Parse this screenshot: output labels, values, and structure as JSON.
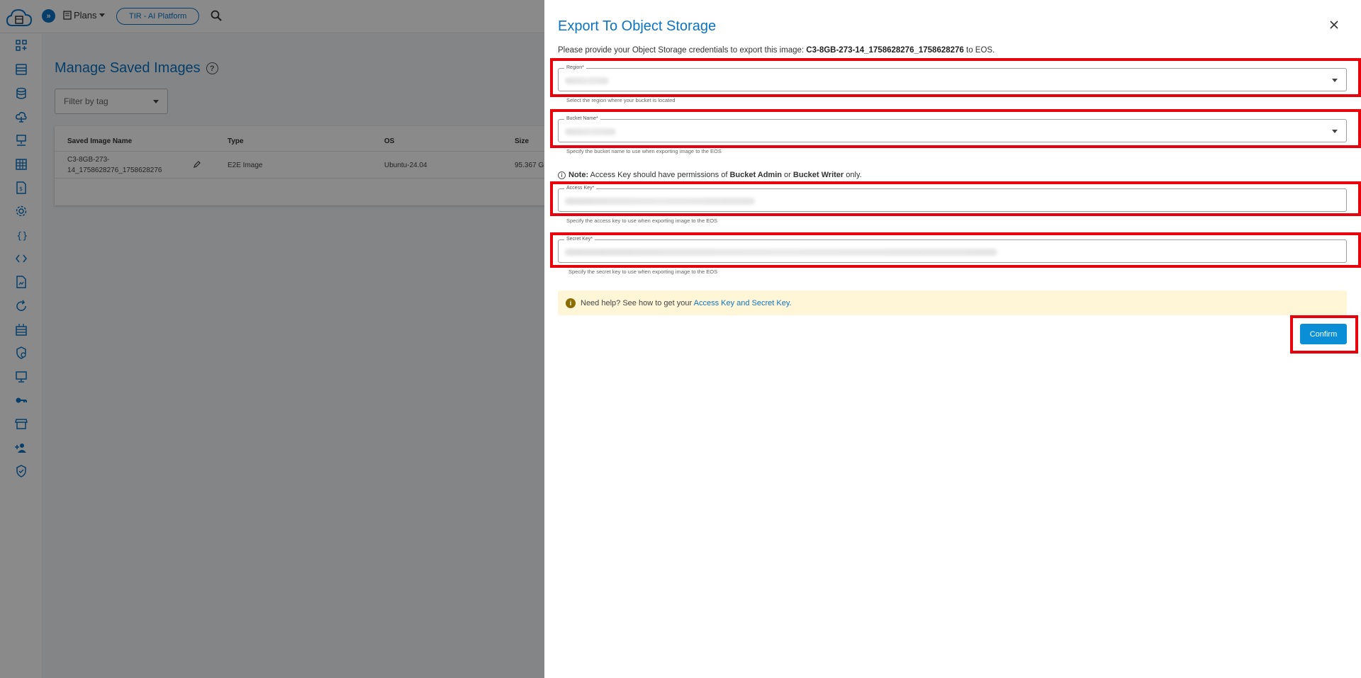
{
  "topbar": {
    "plans_label": "Plans",
    "platform_button": "TIR - AI Platform"
  },
  "sidebar": {
    "icons": [
      "dashboard-add-icon",
      "server-list-icon",
      "database-icon",
      "cloud-upload-icon",
      "network-icon",
      "grid-icon",
      "billing-icon",
      "settings-icon",
      "braces-icon",
      "code-icon",
      "document-icon",
      "refresh-icon",
      "storage-icon",
      "security-settings-icon",
      "monitor-icon",
      "key-icon",
      "store-icon",
      "add-user-icon",
      "shield-icon"
    ]
  },
  "page": {
    "title": "Manage Saved Images",
    "filter_placeholder": "Filter by tag",
    "table": {
      "headers": [
        "Saved Image Name",
        "Type",
        "OS",
        "Size"
      ],
      "rows": [
        {
          "name_line1": "C3-8GB-273-",
          "name_line2": "14_1758628276_1758628276",
          "type": "E2E Image",
          "os": "Ubuntu-24.04",
          "size": "95.367 G"
        }
      ]
    }
  },
  "dialog": {
    "title": "Export To Object Storage",
    "description_prefix": "Please provide your Object Storage credentials to export this image: ",
    "image_name": "C3-8GB-273-14_1758628276_1758628276",
    "description_suffix": " to EOS.",
    "region": {
      "label": "Region*",
      "helper": "Select the region where your bucket is located"
    },
    "bucket": {
      "label": "Bucket Name*",
      "helper": "Specify the bucket name to use when exporting image to the EOS"
    },
    "note": {
      "prefix": "Note:",
      "text1": " Access Key should have permissions of ",
      "role1": "Bucket Admin",
      "text2": " or ",
      "role2": "Bucket Writer",
      "text3": " only."
    },
    "access_key": {
      "label": "Access Key*",
      "helper": "Specify the access key to use when exporting image to the EOS"
    },
    "secret_key": {
      "label": "Secret Key*",
      "helper": "Specify the secret key to use when exporting image to the EOS"
    },
    "help": {
      "text": "Need help? See how to get your ",
      "link": "Access Key and Secret Key."
    },
    "confirm_label": "Confirm"
  },
  "colors": {
    "accent": "#0b74c4",
    "confirm": "#0a8fd6",
    "highlight": "#e8000b",
    "help_bg": "#fff6d8"
  }
}
